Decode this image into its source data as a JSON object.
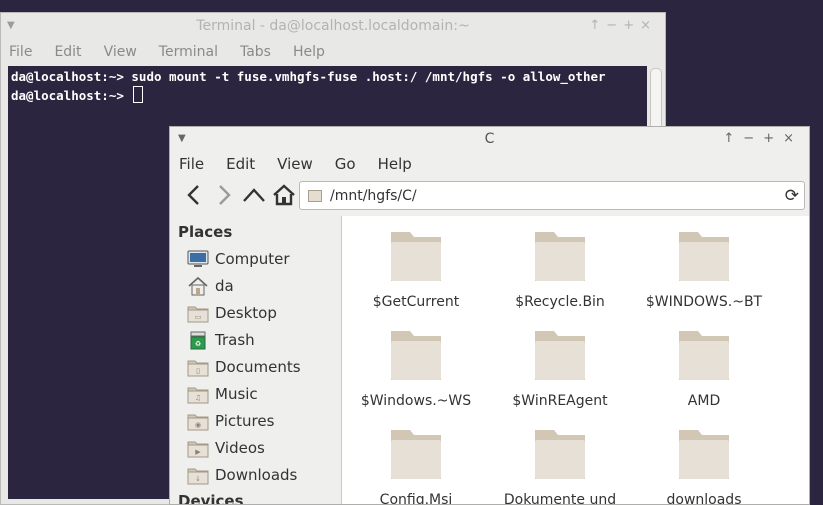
{
  "terminal": {
    "title": "Terminal - da@localhost.localdomain:~",
    "menu": [
      "File",
      "Edit",
      "View",
      "Terminal",
      "Tabs",
      "Help"
    ],
    "lines": [
      "da@localhost:~> sudo mount -t fuse.vmhgfs-fuse .host:/ /mnt/hgfs -o allow_other",
      "da@localhost:~> "
    ]
  },
  "filemanager": {
    "title": "C",
    "menu": [
      "File",
      "Edit",
      "View",
      "Go",
      "Help"
    ],
    "location": "/mnt/hgfs/C/",
    "places_heading": "Places",
    "devices_heading": "Devices",
    "places": [
      {
        "label": "Computer",
        "icon": "computer-icon"
      },
      {
        "label": "da",
        "icon": "home-icon"
      },
      {
        "label": "Desktop",
        "icon": "desktop-folder-icon"
      },
      {
        "label": "Trash",
        "icon": "trash-icon"
      },
      {
        "label": "Documents",
        "icon": "documents-folder-icon"
      },
      {
        "label": "Music",
        "icon": "music-folder-icon"
      },
      {
        "label": "Pictures",
        "icon": "pictures-folder-icon"
      },
      {
        "label": "Videos",
        "icon": "videos-folder-icon"
      },
      {
        "label": "Downloads",
        "icon": "downloads-folder-icon"
      }
    ],
    "files": [
      "$GetCurrent",
      "$Recycle.Bin",
      "$WINDOWS.~BT",
      "$Windows.~WS",
      "$WinREAgent",
      "AMD",
      "Config.Msi",
      "Dokumente und",
      "downloads"
    ]
  },
  "colors": {
    "terminal_bg": "#2b2540",
    "folder_fill": "#e6e0d6",
    "folder_tab": "#d2c7b5"
  }
}
